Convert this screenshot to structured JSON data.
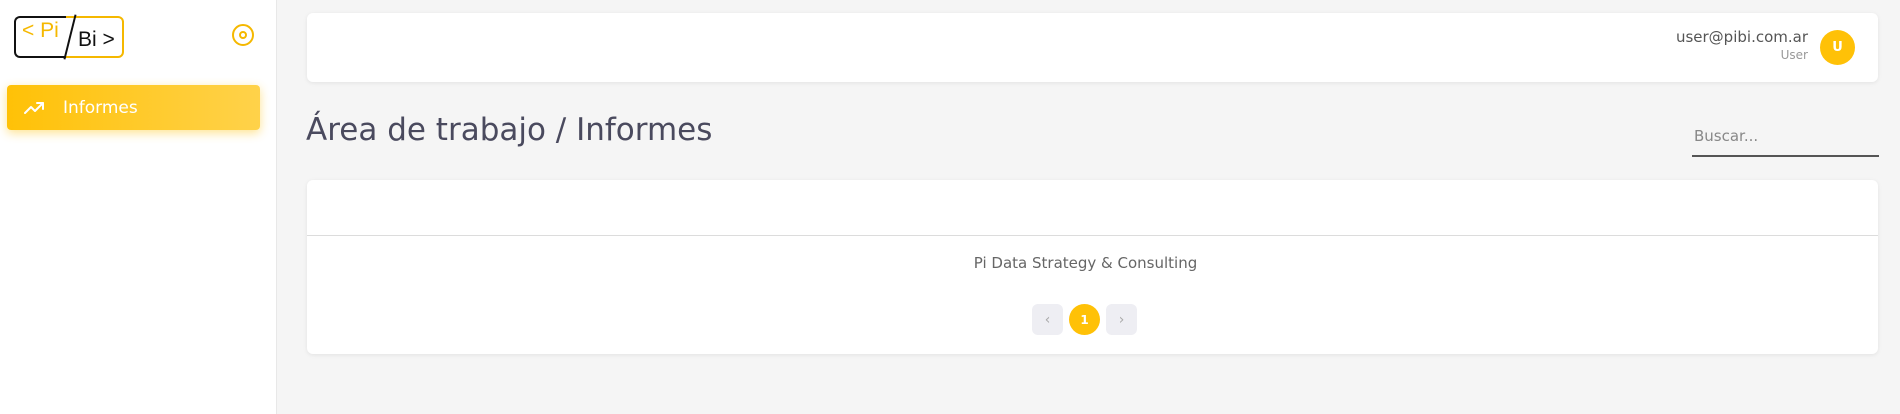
{
  "brand": {
    "logo_left": "< Pi",
    "logo_right": "Bi >",
    "accent_color": "#ffc107"
  },
  "sidebar": {
    "toggle_icon": "radio-target-icon",
    "items": [
      {
        "label": "Informes",
        "icon": "trending-up-icon",
        "active": true
      }
    ]
  },
  "header": {
    "user_email": "user@pibi.com.ar",
    "user_role": "User",
    "avatar_initial": "U"
  },
  "main": {
    "title": "Área de trabajo / Informes",
    "search_placeholder": "Buscar...",
    "card_footer": "Pi Data Strategy & Consulting",
    "pagination": {
      "prev": "‹",
      "current": "1",
      "next": "›"
    }
  }
}
